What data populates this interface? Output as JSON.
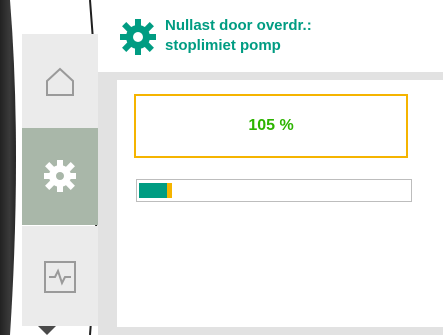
{
  "header": {
    "title_line1": "Nullast door overdr.:",
    "title_line2": "stoplimiet pomp",
    "icon": "gear-icon",
    "accent_color": "#009c82"
  },
  "navigation": {
    "items": [
      {
        "name": "home",
        "icon": "home-icon"
      },
      {
        "name": "settings",
        "icon": "gear-icon",
        "selected": true
      },
      {
        "name": "diagnostics",
        "icon": "pulse-icon"
      }
    ],
    "scroll_indicator": "chevron-down-icon"
  },
  "value": {
    "display": "105 %",
    "border_color": "#f5b400",
    "text_color": "#2db400"
  },
  "progress": {
    "fraction": 0.12,
    "fill_color": "#009c82",
    "marker_color": "#f5b400"
  }
}
